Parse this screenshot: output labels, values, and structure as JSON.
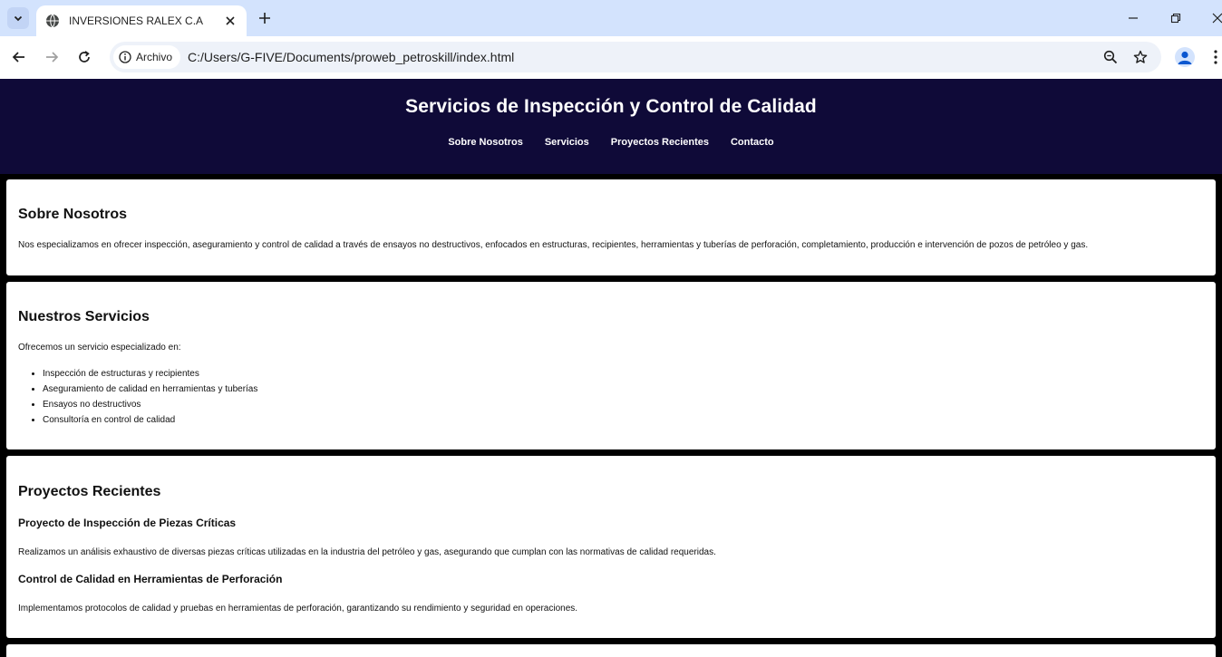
{
  "browser": {
    "tab_title": "INVERSIONES RALEX C.A",
    "site_chip_label": "Archivo",
    "url": "C:/Users/G-FIVE/Documents/proweb_petroskill/index.html"
  },
  "header": {
    "title": "Servicios de Inspección y Control de Calidad",
    "nav": [
      "Sobre Nosotros",
      "Servicios",
      "Proyectos Recientes",
      "Contacto"
    ]
  },
  "about": {
    "heading": "Sobre Nosotros",
    "text": "Nos especializamos en ofrecer inspección, aseguramiento y control de calidad a través de ensayos no destructivos, enfocados en estructuras, recipientes, herramientas y tuberías de perforación, completamiento, producción e intervención de pozos de petróleo y gas."
  },
  "services": {
    "heading": "Nuestros Servicios",
    "intro": "Ofrecemos un servicio especializado en:",
    "items": [
      "Inspección de estructuras y recipientes",
      "Aseguramiento de calidad en herramientas y tuberías",
      "Ensayos no destructivos",
      "Consultoría en control de calidad"
    ]
  },
  "projects": {
    "heading": "Proyectos Recientes",
    "items": [
      {
        "title": "Proyecto de Inspección de Piezas Críticas",
        "text": "Realizamos un análisis exhaustivo de diversas piezas críticas utilizadas en la industria del petróleo y gas, asegurando que cumplan con las normativas de calidad requeridas."
      },
      {
        "title": "Control de Calidad en Herramientas de Perforación",
        "text": "Implementamos protocolos de calidad y pruebas en herramientas de perforación, garantizando su rendimiento y seguridad en operaciones."
      }
    ]
  },
  "colors": {
    "header_bg": "#0f0a38",
    "page_bg": "#000000",
    "card_bg": "#ffffff",
    "tabstrip_bg": "#d3e3fd"
  }
}
